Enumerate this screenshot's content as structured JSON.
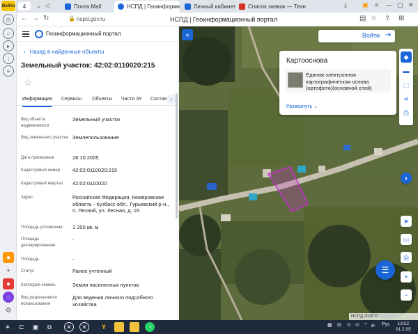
{
  "browser": {
    "logo": "Войти",
    "tab_count": "4",
    "tabs": [
      {
        "title": "Почта Mail",
        "icon": "mail-icon",
        "color": "#1b66d6"
      },
      {
        "title": "НСПД | Геоинформа",
        "icon": "nspd-icon",
        "color": "#1b66d6",
        "active": true
      },
      {
        "title": "Личный кабинет",
        "icon": "cabinet-icon",
        "color": "#1b66d6"
      },
      {
        "title": "Список заявок — Техн",
        "icon": "gmail-icon",
        "color": "#d93025"
      }
    ],
    "url": "nspd.gov.ru",
    "page_title": "НСПД | Геоинформационный портал"
  },
  "panel": {
    "portal_title": "Геоинформационный портал",
    "back_label": "Назад в найденные объекты",
    "object_title": "Земельный участок: 42:02:0110020:215",
    "tabs": [
      "Информация",
      "Сервисы",
      "Объекты",
      "Части ЗУ",
      "Состав"
    ],
    "rows": [
      {
        "label": "Вид объекта недвижимости",
        "value": "Земельный участок"
      },
      {
        "label": "Вид земельного участка",
        "value": "Землепользование"
      },
      {
        "label": "Дата присвоения",
        "value": "28.10.2005"
      },
      {
        "label": "Кадастровый номер",
        "value": "42:02:0110020:215"
      },
      {
        "label": "Кадастровый квартал",
        "value": "42:02:0110020"
      },
      {
        "label": "Адрес",
        "value": "Российская Федерация, Кемеровская область - Кузбасс обл., Гурьевский р-н., п. Лесной, ул. Лесная, д. 16"
      },
      {
        "label": "Площадь уточненная",
        "value": "1 200 кв. м"
      },
      {
        "label": "Площадь декларированная",
        "value": "-"
      },
      {
        "label": "Площадь",
        "value": "-"
      },
      {
        "label": "Статус",
        "value": "Ранее учтенный"
      },
      {
        "label": "Категория земель",
        "value": "Земли населенных пунктов"
      },
      {
        "label": "Вид разрешенного использования",
        "value": "Для ведения личного подсобного хозяйства"
      }
    ]
  },
  "map": {
    "login_label": "Войти",
    "basemap_title": "Картооснова",
    "basemap_item": "Единая электронная картографическая основа (ортофото)(основной слой)",
    "expand_label": "Развернуть",
    "attribution": "НСПД 2025 ©",
    "parcel_color": "#c82fd0",
    "accent_color": "#1b66d6"
  },
  "taskbar": {
    "lang": "Рус",
    "time": "13:52",
    "date": "01.2.05"
  }
}
